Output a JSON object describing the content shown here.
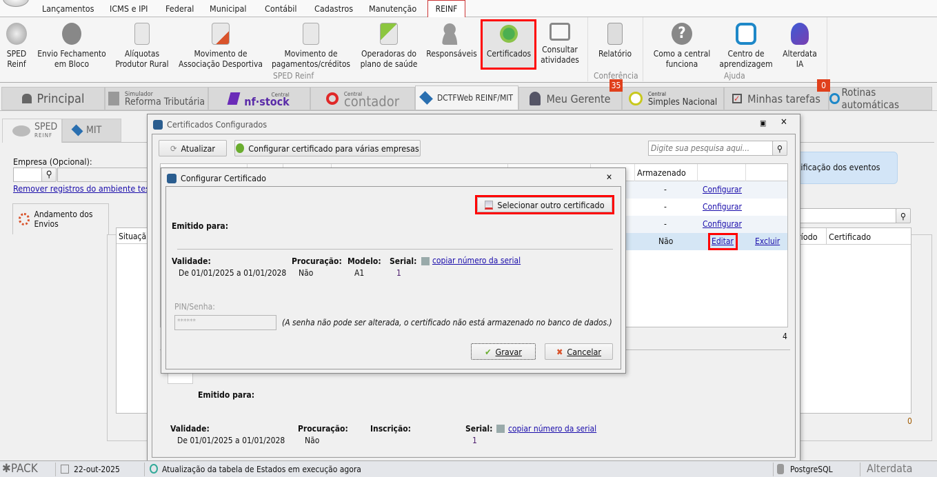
{
  "menu": {
    "items": [
      "Lançamentos",
      "ICMS e IPI",
      "Federal",
      "Municipal",
      "Contábil",
      "Cadastros",
      "Manutenção"
    ],
    "active": "REINF"
  },
  "ribbon": {
    "buttons": [
      {
        "label": "SPED\nReinf",
        "icon": "sped-disk-icon"
      },
      {
        "label": "Envio Fechamento\nem Bloco",
        "icon": "lock-icon"
      },
      {
        "label": "Alíquotas\nProdutor Rural",
        "icon": "document-icon"
      },
      {
        "label": "Movimento de\nAssociação Desportiva",
        "icon": "list-transfer-icon"
      },
      {
        "label": "Movimento de\npagamentos/créditos",
        "icon": "list-icon"
      },
      {
        "label": "Operadoras do\nplano de saúde",
        "icon": "add-document-icon"
      },
      {
        "label": "Responsáveis",
        "icon": "add-user-icon"
      },
      {
        "label": "Certificados",
        "icon": "certificate-icon"
      },
      {
        "label": "Consultar\natividades",
        "icon": "monitor-icon"
      },
      {
        "label": "Relatório",
        "icon": "report-icon"
      },
      {
        "label": "Como a central\nfunciona",
        "icon": "help-icon"
      },
      {
        "label": "Centro de\naprendizagem",
        "icon": "learning-icon"
      },
      {
        "label": "Alterdata\nIA",
        "icon": "ai-head-icon"
      }
    ],
    "groups": [
      "SPED Reinf",
      "Conferência",
      "Ajuda"
    ]
  },
  "tabs": {
    "principal": "Principal",
    "simulador_small": "Simulador",
    "simulador": "Reforma Tributária",
    "nfstock_small": "Central",
    "nfstock": "nf·stock",
    "contador_small": "Central",
    "contador": "contador",
    "dctf": "DCTFWeb REINF/MIT",
    "gerente": "Meu Gerente",
    "simples_small": "Central",
    "simples": "Simples Nacional",
    "tarefas": "Minhas tarefas",
    "rotinas": "Rotinas automáticas",
    "badge_gerente": "35",
    "badge_tarefas": "0"
  },
  "left": {
    "tab_sped": "SPED",
    "tab_sped_sub": "REINF",
    "tab_mit": "MIT",
    "empresa_label": "Empresa (Opcional):",
    "remove_link": "Remover registros do ambiente teste",
    "andamento": "Andamento dos Envios",
    "situacao_header": "Situaçã"
  },
  "right": {
    "info_text": "tificação dos eventos",
    "col_periodo": "ríodo",
    "col_certificado": "Certificado",
    "count": "0"
  },
  "cert_window": {
    "title": "Certificados Configurados",
    "atualizar": "Atualizar",
    "configurar_varias": "Configurar certificado para várias empresas",
    "search_placeholder": "Digite sua pesquisa aqui...",
    "col_armazenado": "Armazenado",
    "rows": [
      {
        "armazenado": "-",
        "action1": "Configurar",
        "action2": ""
      },
      {
        "armazenado": "-",
        "action1": "Configurar",
        "action2": ""
      },
      {
        "armazenado": "-",
        "action1": "Configurar",
        "action2": ""
      },
      {
        "armazenado": "Não",
        "action1": "Editar",
        "action2": "Excluir"
      }
    ],
    "count": "4",
    "detail": {
      "emitido": "Emitido para:",
      "validade_label": "Validade:",
      "validade": "De 01/01/2025 a 01/01/2028",
      "procuracao_label": "Procuração:",
      "procuracao": "Não",
      "inscricao_label": "Inscrição:",
      "serial_label": "Serial:",
      "copy_serial": "copiar número da serial",
      "serial": "1"
    }
  },
  "dialog": {
    "title": "Configurar Certificado",
    "select_other": "Selecionar outro certificado",
    "emitido": "Emitido para:",
    "validade_label": "Validade:",
    "validade": "De 01/01/2025 a 01/01/2028",
    "procuracao_label": "Procuração:",
    "procuracao": "Não",
    "modelo_label": "Modelo:",
    "modelo": "A1",
    "serial_label": "Serial:",
    "serial": "1",
    "copy_serial": "copiar número da serial",
    "pin_label": "PIN/Senha:",
    "pin_value": "******",
    "pin_note": "(A senha não pode ser alterada, o certificado não está armazenado no banco de dados.)",
    "gravar": "Gravar",
    "cancelar": "Cancelar"
  },
  "status": {
    "pack": "PACK",
    "date": "22-out-2025",
    "message": "Atualização da tabela de Estados em execução agora",
    "db": "PostgreSQL",
    "brand": "Alterdata"
  },
  "colors": {
    "highlight": "#ff0000",
    "badge": "#e0401c",
    "selected_row": "#d5e6f5",
    "link": "#1a0dab"
  }
}
